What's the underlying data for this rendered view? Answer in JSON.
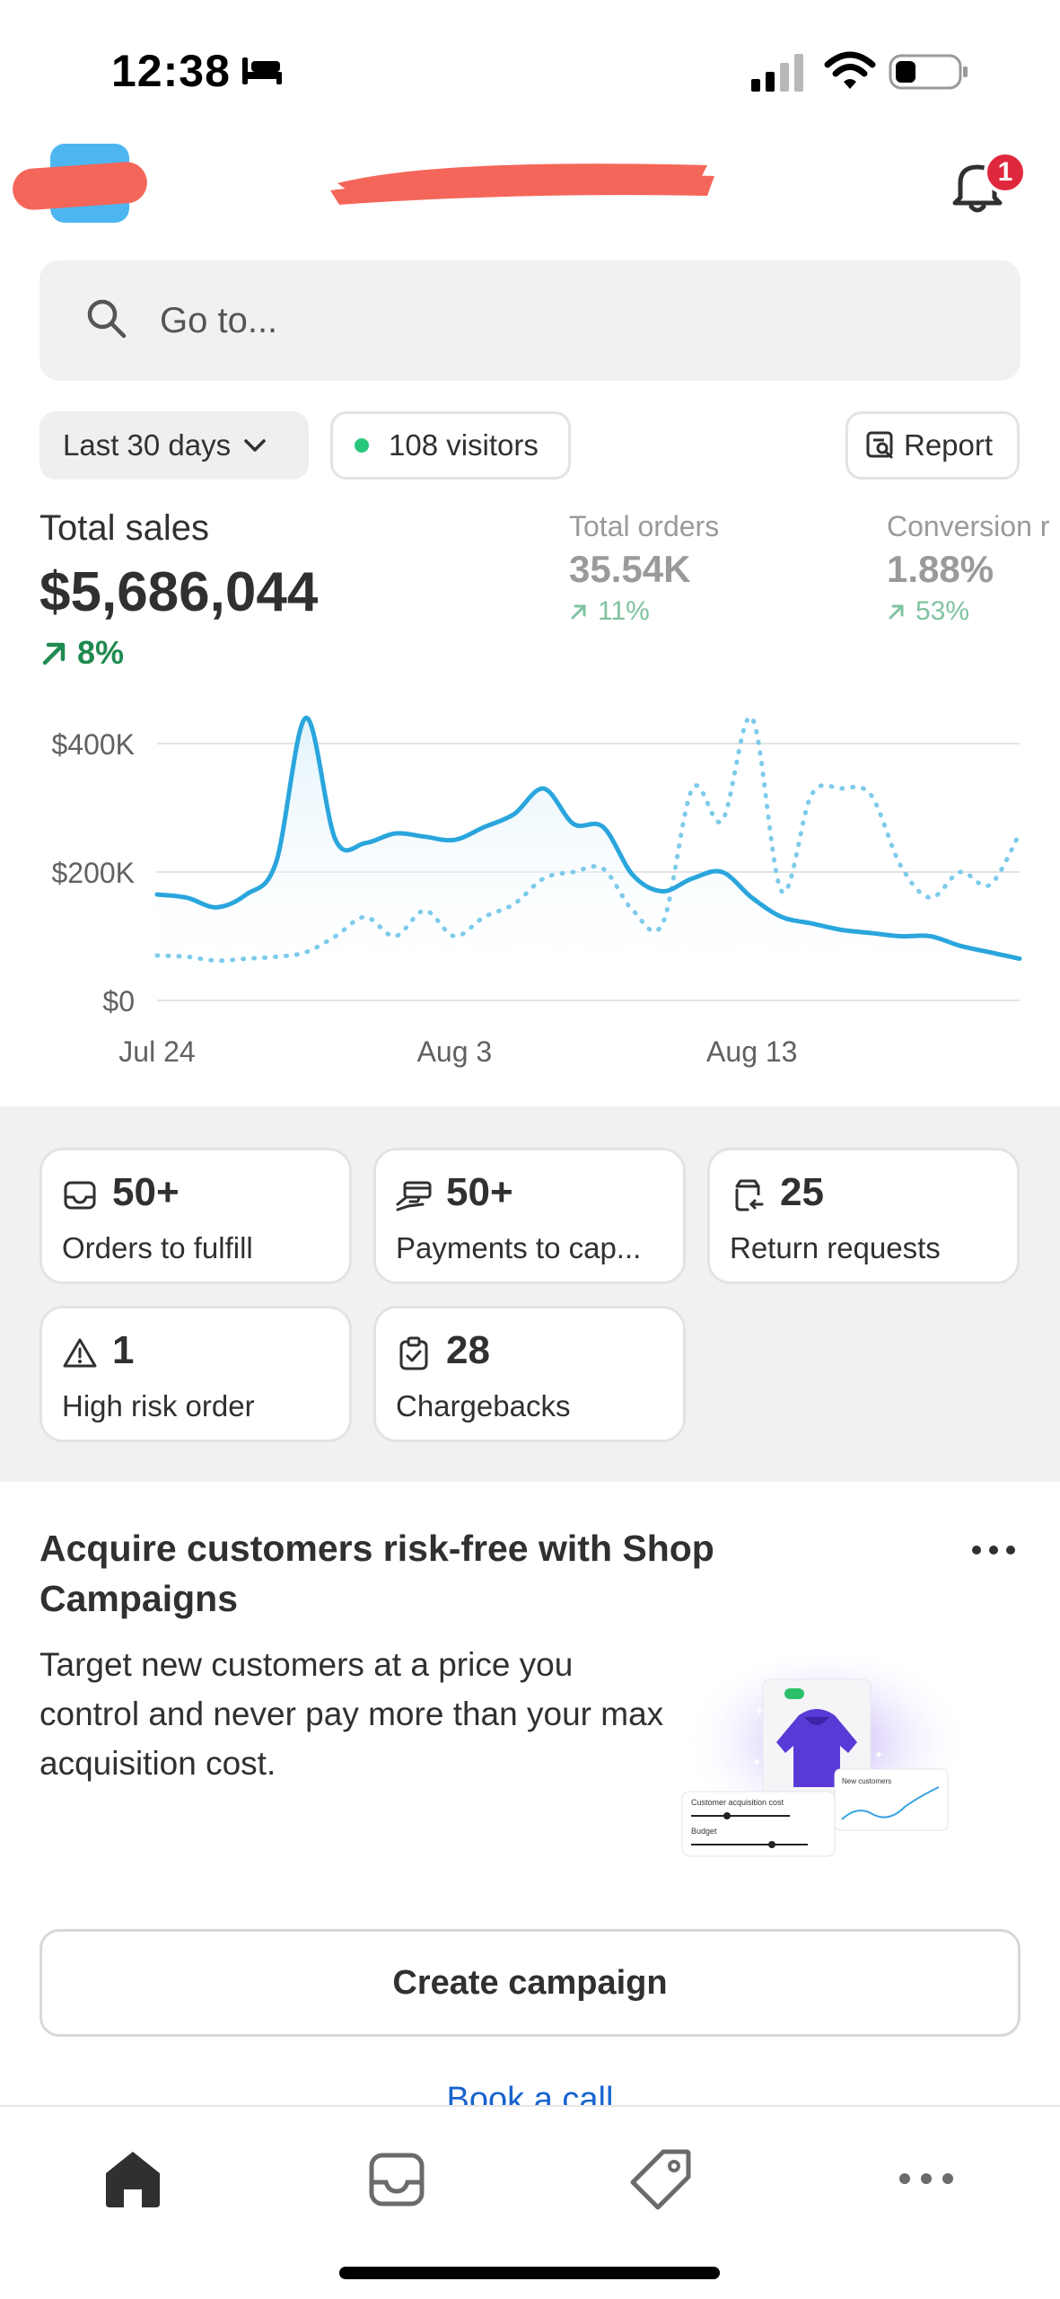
{
  "status_bar": {
    "time": "12:38"
  },
  "header": {
    "notification_count": "1"
  },
  "search": {
    "placeholder": "Go to..."
  },
  "filters": {
    "range_label": "Last 30 days",
    "visitors_label": "108 visitors",
    "report_label": "Report"
  },
  "metrics": {
    "total_sales": {
      "label": "Total sales",
      "value": "$5,686,044",
      "change": "8%"
    },
    "total_orders": {
      "label": "Total orders",
      "value": "35.54K",
      "change": "11%"
    },
    "conversion": {
      "label": "Conversion r",
      "value": "1.88%",
      "change": "53%"
    }
  },
  "chart_data": {
    "type": "line",
    "x_tick_labels": [
      "Jul 24",
      "Aug 3",
      "Aug 13"
    ],
    "y_tick_labels": [
      "$400K",
      "$200K",
      "$0"
    ],
    "ylim": [
      0,
      400000
    ],
    "grid": true,
    "x": [
      1,
      2,
      3,
      4,
      5,
      6,
      7,
      8,
      9,
      10,
      11,
      12,
      13,
      14,
      15,
      16,
      17,
      18,
      19,
      20,
      21,
      22,
      23,
      24,
      25,
      26,
      27,
      28,
      29,
      30
    ],
    "series": [
      {
        "style": "solid",
        "values": [
          165000,
          160000,
          145000,
          165000,
          215000,
          440000,
          250000,
          245000,
          260000,
          255000,
          250000,
          270000,
          290000,
          330000,
          275000,
          270000,
          195000,
          170000,
          190000,
          200000,
          160000,
          130000,
          120000,
          110000,
          105000,
          100000,
          100000,
          85000,
          75000,
          65000
        ]
      },
      {
        "style": "dotted",
        "values": [
          70000,
          68000,
          62000,
          65000,
          68000,
          75000,
          100000,
          130000,
          100000,
          140000,
          100000,
          130000,
          150000,
          190000,
          200000,
          205000,
          140000,
          120000,
          330000,
          280000,
          440000,
          170000,
          320000,
          330000,
          320000,
          210000,
          160000,
          200000,
          180000,
          260000
        ]
      }
    ],
    "colors": {
      "solid": "#2aa6dd",
      "dotted": "#7dcbeb"
    }
  },
  "tasks": [
    {
      "icon": "inbox-icon",
      "count": "50+",
      "label": "Orders to fulfill"
    },
    {
      "icon": "payment-hand-icon",
      "count": "50+",
      "label": "Payments to cap..."
    },
    {
      "icon": "return-icon",
      "count": "25",
      "label": "Return requests"
    },
    {
      "icon": "alert-triangle-icon",
      "count": "1",
      "label": "High risk order"
    },
    {
      "icon": "clipboard-check-icon",
      "count": "28",
      "label": "Chargebacks"
    }
  ],
  "promo": {
    "title": "Acquire customers risk-free with Shop Campaigns",
    "body": "Target new customers at a price you control and never pay more than your max acquisition cost.",
    "art_labels": {
      "cac": "Customer acquisition cost",
      "budget": "Budget",
      "new_customers": "New customers"
    },
    "cta": "Create campaign",
    "link": "Book a call"
  },
  "colors": {
    "accent_green": "#1f8a50",
    "badge_red": "#e0283c",
    "link_blue": "#1763cf"
  }
}
